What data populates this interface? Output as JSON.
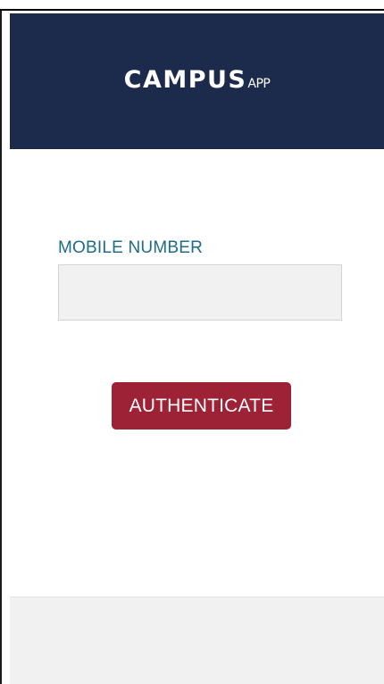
{
  "app": {
    "logo_main": "CAMPUS",
    "logo_sub": "APP"
  },
  "form": {
    "mobile_label": "MOBILE NUMBER",
    "mobile_value": "",
    "mobile_placeholder": "",
    "authenticate_label": "AUTHENTICATE"
  },
  "colors": {
    "header_background": "#1c2a4b",
    "label_text": "#1f6b8c",
    "button_background": "#9e2235",
    "input_background": "#f1f1f1",
    "footer_background": "#f1f1f1"
  }
}
